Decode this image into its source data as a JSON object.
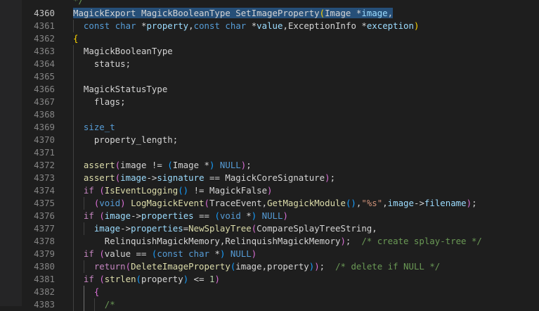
{
  "colors": {
    "editor_bg": "#1e1e1e",
    "line_number": "#858585",
    "line_number_active": "#c6c6c6",
    "selection": "#264f78",
    "default": "#d4d4d4",
    "type": "#4ec9b0",
    "keyword": "#569cd6",
    "control": "#c586c0",
    "function": "#dcdcaa",
    "param": "#9cdcfe",
    "string": "#ce9178",
    "comment": "#6a9955",
    "number": "#b5cea8",
    "bracket1": "#ffd700",
    "bracket2": "#da70d6",
    "bracket3": "#179fff"
  },
  "lines": [
    {
      "num": "",
      "tokens": [
        {
          "t": "*/",
          "c": "comment"
        }
      ]
    },
    {
      "num": "4360",
      "active": true,
      "tokens": [
        {
          "t": "MagickExport MagickBooleanType SetImageProperty",
          "c": "default",
          "sel": true
        },
        {
          "t": "(",
          "c": "bracket1",
          "sel": true
        },
        {
          "t": "Image ",
          "c": "default",
          "sel": true
        },
        {
          "t": "*",
          "c": "default",
          "sel": true
        },
        {
          "t": "image",
          "c": "param",
          "sel": true
        },
        {
          "t": ",",
          "c": "default",
          "sel": true
        }
      ]
    },
    {
      "num": "4361",
      "tokens": [
        {
          "t": "  ",
          "c": "default"
        },
        {
          "t": "const",
          "c": "keyword"
        },
        {
          "t": " ",
          "c": "default"
        },
        {
          "t": "char",
          "c": "keyword"
        },
        {
          "t": " *",
          "c": "default"
        },
        {
          "t": "property",
          "c": "param"
        },
        {
          "t": ",",
          "c": "default"
        },
        {
          "t": "const",
          "c": "keyword"
        },
        {
          "t": " ",
          "c": "default"
        },
        {
          "t": "char",
          "c": "keyword"
        },
        {
          "t": " *",
          "c": "default"
        },
        {
          "t": "value",
          "c": "param"
        },
        {
          "t": ",ExceptionInfo *",
          "c": "default"
        },
        {
          "t": "exception",
          "c": "param"
        },
        {
          "t": ")",
          "c": "bracket1"
        }
      ]
    },
    {
      "num": "4362",
      "tokens": [
        {
          "t": "{",
          "c": "bracket1"
        }
      ]
    },
    {
      "num": "4363",
      "tokens": [
        {
          "t": "  MagickBooleanType",
          "c": "default"
        }
      ]
    },
    {
      "num": "4364",
      "tokens": [
        {
          "t": "    status;",
          "c": "default"
        }
      ]
    },
    {
      "num": "4365",
      "tokens": []
    },
    {
      "num": "4366",
      "tokens": [
        {
          "t": "  MagickStatusType",
          "c": "default"
        }
      ]
    },
    {
      "num": "4367",
      "tokens": [
        {
          "t": "    flags;",
          "c": "default"
        }
      ]
    },
    {
      "num": "4368",
      "tokens": []
    },
    {
      "num": "4369",
      "tokens": [
        {
          "t": "  ",
          "c": "default"
        },
        {
          "t": "size_t",
          "c": "keyword"
        }
      ]
    },
    {
      "num": "4370",
      "tokens": [
        {
          "t": "    property_length;",
          "c": "default"
        }
      ]
    },
    {
      "num": "4371",
      "tokens": []
    },
    {
      "num": "4372",
      "tokens": [
        {
          "t": "  ",
          "c": "default"
        },
        {
          "t": "assert",
          "c": "function"
        },
        {
          "t": "(",
          "c": "bracket2"
        },
        {
          "t": "image != ",
          "c": "default"
        },
        {
          "t": "(",
          "c": "bracket3"
        },
        {
          "t": "Image *",
          "c": "default"
        },
        {
          "t": ")",
          "c": "bracket3"
        },
        {
          "t": " ",
          "c": "default"
        },
        {
          "t": "NULL",
          "c": "keyword"
        },
        {
          "t": ")",
          "c": "bracket2"
        },
        {
          "t": ";",
          "c": "default"
        }
      ]
    },
    {
      "num": "4373",
      "tokens": [
        {
          "t": "  ",
          "c": "default"
        },
        {
          "t": "assert",
          "c": "function"
        },
        {
          "t": "(",
          "c": "bracket2"
        },
        {
          "t": "image",
          "c": "param"
        },
        {
          "t": "->",
          "c": "default"
        },
        {
          "t": "signature",
          "c": "param"
        },
        {
          "t": " == MagickCoreSignature",
          "c": "default"
        },
        {
          "t": ")",
          "c": "bracket2"
        },
        {
          "t": ";",
          "c": "default"
        }
      ]
    },
    {
      "num": "4374",
      "tokens": [
        {
          "t": "  ",
          "c": "default"
        },
        {
          "t": "if",
          "c": "control"
        },
        {
          "t": " ",
          "c": "default"
        },
        {
          "t": "(",
          "c": "bracket2"
        },
        {
          "t": "IsEventLogging",
          "c": "function"
        },
        {
          "t": "()",
          "c": "bracket3"
        },
        {
          "t": " != MagickFalse",
          "c": "default"
        },
        {
          "t": ")",
          "c": "bracket2"
        }
      ]
    },
    {
      "num": "4375",
      "tokens": [
        {
          "t": "    ",
          "c": "default"
        },
        {
          "t": "(",
          "c": "bracket2"
        },
        {
          "t": "void",
          "c": "keyword"
        },
        {
          "t": ")",
          "c": "bracket2"
        },
        {
          "t": " ",
          "c": "default"
        },
        {
          "t": "LogMagickEvent",
          "c": "function"
        },
        {
          "t": "(",
          "c": "bracket2"
        },
        {
          "t": "TraceEvent,",
          "c": "default"
        },
        {
          "t": "GetMagickModule",
          "c": "function"
        },
        {
          "t": "()",
          "c": "bracket3"
        },
        {
          "t": ",",
          "c": "default"
        },
        {
          "t": "\"%s\"",
          "c": "string"
        },
        {
          "t": ",",
          "c": "default"
        },
        {
          "t": "image",
          "c": "param"
        },
        {
          "t": "->",
          "c": "default"
        },
        {
          "t": "filename",
          "c": "param"
        },
        {
          "t": ")",
          "c": "bracket2"
        },
        {
          "t": ";",
          "c": "default"
        }
      ]
    },
    {
      "num": "4376",
      "tokens": [
        {
          "t": "  ",
          "c": "default"
        },
        {
          "t": "if",
          "c": "control"
        },
        {
          "t": " ",
          "c": "default"
        },
        {
          "t": "(",
          "c": "bracket2"
        },
        {
          "t": "image",
          "c": "param"
        },
        {
          "t": "->",
          "c": "default"
        },
        {
          "t": "properties",
          "c": "param"
        },
        {
          "t": " == ",
          "c": "default"
        },
        {
          "t": "(",
          "c": "bracket3"
        },
        {
          "t": "void",
          "c": "keyword"
        },
        {
          "t": " *",
          "c": "default"
        },
        {
          "t": ")",
          "c": "bracket3"
        },
        {
          "t": " ",
          "c": "default"
        },
        {
          "t": "NULL",
          "c": "keyword"
        },
        {
          "t": ")",
          "c": "bracket2"
        }
      ]
    },
    {
      "num": "4377",
      "tokens": [
        {
          "t": "    ",
          "c": "default"
        },
        {
          "t": "image",
          "c": "param"
        },
        {
          "t": "->",
          "c": "default"
        },
        {
          "t": "properties",
          "c": "param"
        },
        {
          "t": "=",
          "c": "default"
        },
        {
          "t": "NewSplayTree",
          "c": "function"
        },
        {
          "t": "(",
          "c": "bracket2"
        },
        {
          "t": "CompareSplayTreeString,",
          "c": "default"
        }
      ]
    },
    {
      "num": "4378",
      "tokens": [
        {
          "t": "      RelinquishMagickMemory,RelinquishMagickMemory",
          "c": "default"
        },
        {
          "t": ")",
          "c": "bracket2"
        },
        {
          "t": ";  ",
          "c": "default"
        },
        {
          "t": "/* create splay-tree */",
          "c": "comment"
        }
      ]
    },
    {
      "num": "4379",
      "tokens": [
        {
          "t": "  ",
          "c": "default"
        },
        {
          "t": "if",
          "c": "control"
        },
        {
          "t": " ",
          "c": "default"
        },
        {
          "t": "(",
          "c": "bracket2"
        },
        {
          "t": "value == ",
          "c": "default"
        },
        {
          "t": "(",
          "c": "bracket3"
        },
        {
          "t": "const",
          "c": "keyword"
        },
        {
          "t": " ",
          "c": "default"
        },
        {
          "t": "char",
          "c": "keyword"
        },
        {
          "t": " *",
          "c": "default"
        },
        {
          "t": ")",
          "c": "bracket3"
        },
        {
          "t": " ",
          "c": "default"
        },
        {
          "t": "NULL",
          "c": "keyword"
        },
        {
          "t": ")",
          "c": "bracket2"
        }
      ]
    },
    {
      "num": "4380",
      "tokens": [
        {
          "t": "    ",
          "c": "default"
        },
        {
          "t": "return",
          "c": "control"
        },
        {
          "t": "(",
          "c": "bracket2"
        },
        {
          "t": "DeleteImageProperty",
          "c": "function"
        },
        {
          "t": "(",
          "c": "bracket3"
        },
        {
          "t": "image,property",
          "c": "default"
        },
        {
          "t": ")",
          "c": "bracket3"
        },
        {
          "t": ")",
          "c": "bracket2"
        },
        {
          "t": ";  ",
          "c": "default"
        },
        {
          "t": "/* delete if NULL */",
          "c": "comment"
        }
      ]
    },
    {
      "num": "4381",
      "tokens": [
        {
          "t": "  ",
          "c": "default"
        },
        {
          "t": "if",
          "c": "control"
        },
        {
          "t": " ",
          "c": "default"
        },
        {
          "t": "(",
          "c": "bracket2"
        },
        {
          "t": "strlen",
          "c": "function"
        },
        {
          "t": "(",
          "c": "bracket3"
        },
        {
          "t": "property",
          "c": "default"
        },
        {
          "t": ")",
          "c": "bracket3"
        },
        {
          "t": " <= ",
          "c": "default"
        },
        {
          "t": "1",
          "c": "number"
        },
        {
          "t": ")",
          "c": "bracket2"
        }
      ]
    },
    {
      "num": "4382",
      "tokens": [
        {
          "t": "    ",
          "c": "default"
        },
        {
          "t": "{",
          "c": "bracket2"
        }
      ]
    },
    {
      "num": "4383",
      "tokens": [
        {
          "t": "      ",
          "c": "default"
        },
        {
          "t": "/*",
          "c": "comment"
        }
      ]
    }
  ]
}
